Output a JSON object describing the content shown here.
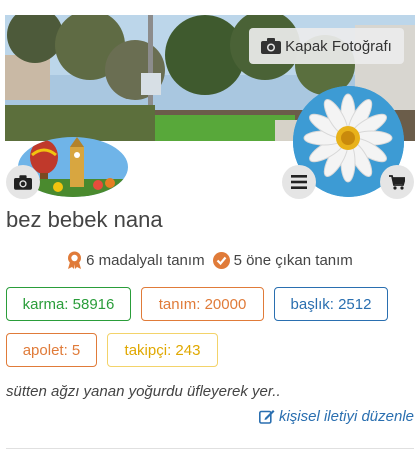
{
  "cover": {
    "button_label": "Kapak Fotoğrafı"
  },
  "profile": {
    "username": "bez bebek nana"
  },
  "medals": {
    "medal_text": "6 madalyalı tanım",
    "featured_text": "5 öne çıkan tanım"
  },
  "stats": {
    "karma": "karma: 58916",
    "tanim": "tanım: 20000",
    "baslik": "başlık: 2512",
    "apolet": "apolet: 5",
    "takipci": "takipçi: 243"
  },
  "bio": {
    "text": "sütten ağzı yanan yoğurdu üfleyerek yer..",
    "edit_label": "kişisel iletiyi düzenle"
  },
  "colors": {
    "karma": "#2a9d3a",
    "tanim": "#e07b39",
    "baslik": "#2a6fb0",
    "apolet": "#e07b39",
    "takipci": "#e0a800",
    "link": "#2a6fb0"
  },
  "icons": [
    "camera-icon",
    "menu-icon",
    "cart-icon",
    "medal-icon",
    "check-badge-icon",
    "edit-icon"
  ]
}
